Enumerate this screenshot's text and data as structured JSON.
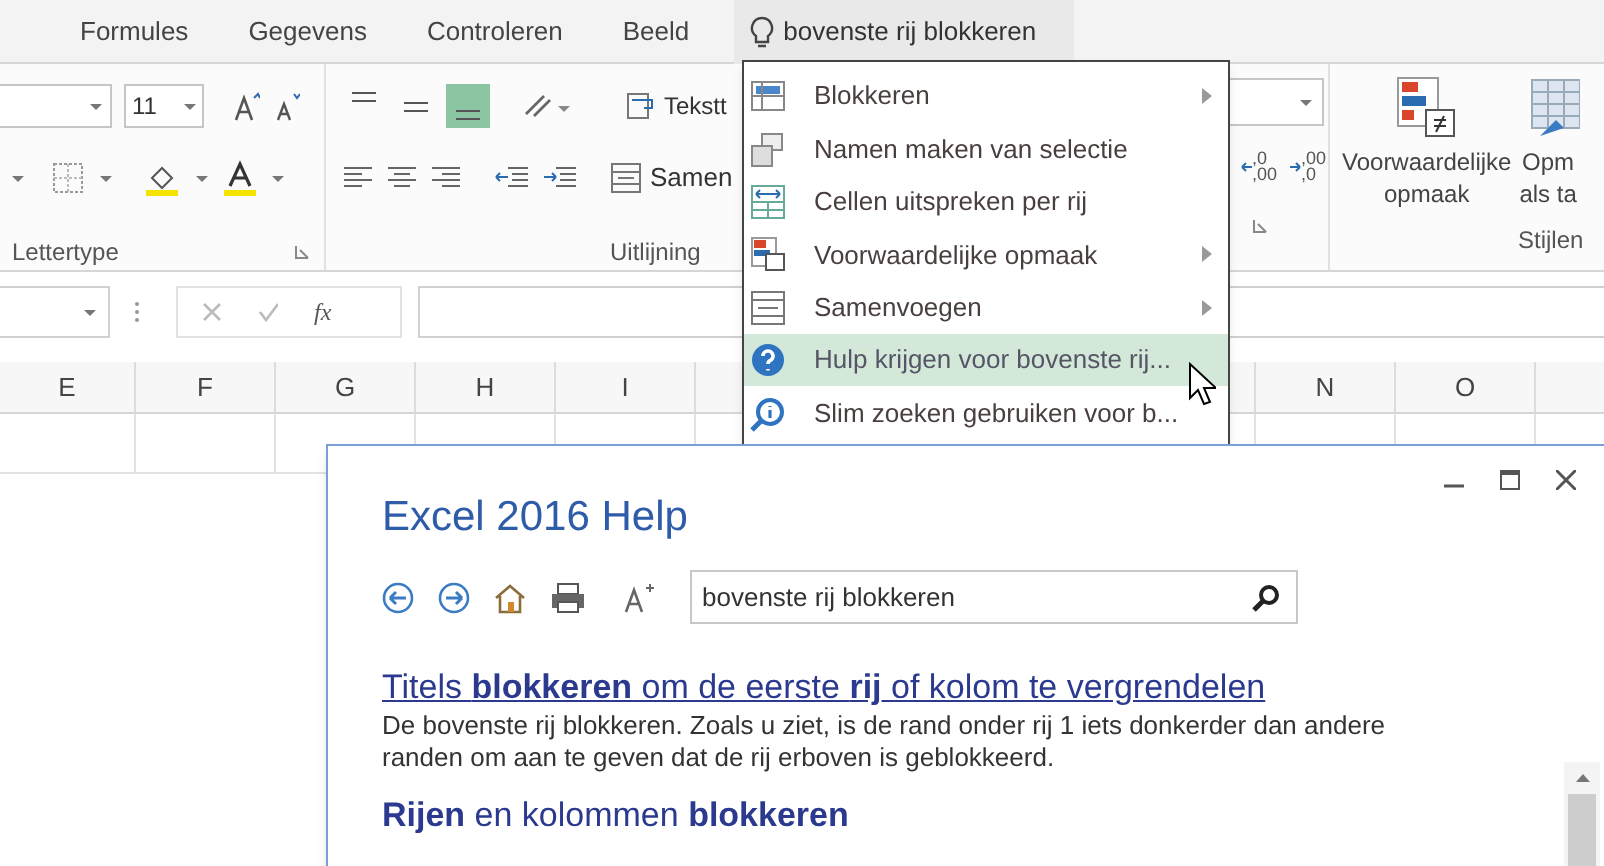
{
  "ribbon_tabs": [
    {
      "label": "Formules"
    },
    {
      "label": "Gegevens"
    },
    {
      "label": "Controleren"
    },
    {
      "label": "Beeld"
    }
  ],
  "tell_me": {
    "value": "bovenste rij blokkeren"
  },
  "ribbon": {
    "font_size": "11",
    "alignment_buttons": [
      {
        "selected": false
      },
      {
        "selected": false
      },
      {
        "selected": true
      }
    ],
    "wrap_text_button": "Tekstt",
    "merge_button": "Samen",
    "decimal_buttons": [
      {
        "top": ",0",
        "bottom": ",00"
      },
      {
        "top": ",00",
        "bottom": ",0"
      }
    ],
    "conditional_format_button": [
      "Voorwaardelijke",
      "opmaak"
    ],
    "format_table_button": [
      "Opm",
      "als ta"
    ],
    "groups": [
      "Lettertype",
      "Uitlijning",
      "Stijlen"
    ]
  },
  "formula_bar": {
    "function_button": "fx"
  },
  "column_headers_left": [
    "E",
    "F",
    "G",
    "H",
    "I"
  ],
  "column_headers_right": [
    "N",
    "O"
  ],
  "menu": {
    "items": [
      {
        "label": "Blokkeren",
        "submenu": true,
        "selected": false
      },
      {
        "label": "Namen maken van selectie",
        "submenu": false,
        "selected": false
      },
      {
        "label": "Cellen uitspreken per rij",
        "submenu": false,
        "selected": false
      },
      {
        "label": "Voorwaardelijke opmaak",
        "submenu": true,
        "selected": false
      },
      {
        "label": "Samenvoegen",
        "submenu": true,
        "selected": false
      },
      {
        "label": "Hulp krijgen voor bovenste rij...",
        "submenu": false,
        "selected": true
      },
      {
        "label": "Slim zoeken gebruiken voor b...",
        "submenu": false,
        "selected": false
      }
    ]
  },
  "help_window": {
    "title": "Excel 2016 Help",
    "search": {
      "value": "bovenste rij blokkeren"
    },
    "results": [
      {
        "title": "Titels **blokkeren** om de eerste **rij** of kolom te vergrendelen",
        "snippet": "De bovenste rij blokkeren. Zoals u ziet, is de rand onder rij 1 iets donkerder dan andere randen om aan te geven dat de rij erboven is geblokkeerd."
      },
      {
        "title": "**Rijen** en kolommen **blokkeren**"
      }
    ]
  }
}
